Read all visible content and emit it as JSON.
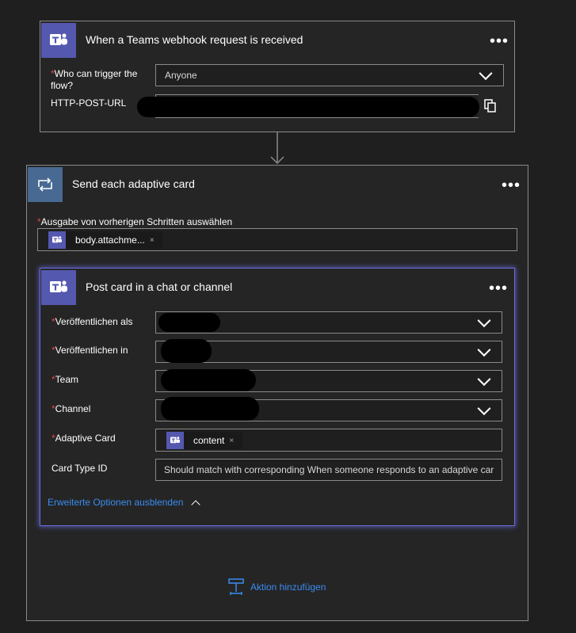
{
  "trigger": {
    "title": "When a Teams webhook request is received",
    "more": "•••",
    "who_label": "Who can trigger the flow?",
    "who_value": "Anyone",
    "url_label": "HTTP-POST-URL",
    "required_mark": "*"
  },
  "loop": {
    "title": "Send each adaptive card",
    "more": "•••",
    "select_label": "Ausgabe von vorherigen Schritten auswählen",
    "token": "body.attachme...",
    "token_remove": "×",
    "required_mark": "*",
    "add_action": "Aktion hinzufügen"
  },
  "post": {
    "title": "Post card in a chat or channel",
    "more": "•••",
    "required_mark": "*",
    "post_as_label": "Veröffentlichen als",
    "post_in_label": "Veröffentlichen in",
    "team_label": "Team",
    "channel_label": "Channel",
    "card_label": "Adaptive Card",
    "card_token": "content",
    "card_token_remove": "×",
    "card_type_label": "Card Type ID",
    "card_type_value": "Should match with corresponding When someone responds to an adaptive car",
    "advanced_toggle": "Erweiterte Optionen ausblenden"
  },
  "colors": {
    "teams_purple": "#5558af",
    "loop_blue": "#486991",
    "link_blue": "#3a8cf0",
    "required_red": "#e24848"
  }
}
